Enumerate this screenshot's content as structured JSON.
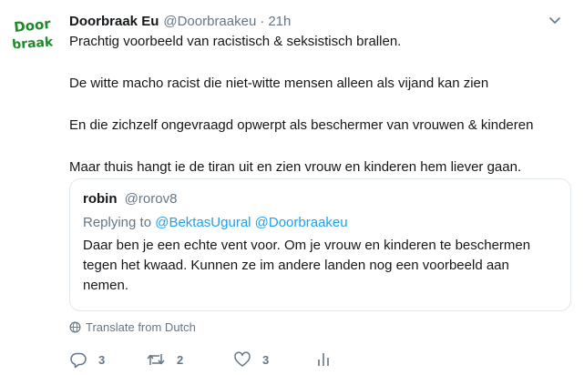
{
  "tweet": {
    "author_name": "Doorbraak Eu",
    "author_handle": "@Doorbraakeu",
    "separator": "·",
    "time": "21h",
    "avatar_text_line1": "Door",
    "avatar_text_line2": "braak",
    "avatar_color": "#1f8a2c",
    "lines": [
      "Prachtig voorbeeld van racistisch & seksistisch brallen.",
      "De witte macho racist die niet-witte mensen alleen als vijand kan zien",
      "En die zichzelf ongevraagd opwerpt als beschermer van vrouwen & kinderen",
      "Maar thuis hangt ie de tiran uit en zien vrouw en kinderen hem liever gaan."
    ]
  },
  "quoted": {
    "author_name": "robin",
    "author_handle": "@rorov8",
    "replying_prefix": "Replying to",
    "replying_to": "@BektasUgural @Doorbraakeu",
    "lines": [
      "Daar ben je een echte vent voor. Om je vrouw en kinderen te beschermen",
      "tegen het kwaad. Kunnen ze im andere landen nog een voorbeeld aan",
      "nemen."
    ]
  },
  "translate_label": "Translate from Dutch",
  "actions": {
    "reply_count": "3",
    "retweet_count": "2",
    "like_count": "3"
  },
  "icons": {
    "caret": "chevron-down-icon",
    "globe": "globe-icon",
    "reply": "reply-icon",
    "retweet": "retweet-icon",
    "like": "heart-icon",
    "analytics": "analytics-icon"
  },
  "colors": {
    "text": "#14171a",
    "secondary": "#657786",
    "link": "#1da1f2",
    "border": "#e1e8ed"
  }
}
